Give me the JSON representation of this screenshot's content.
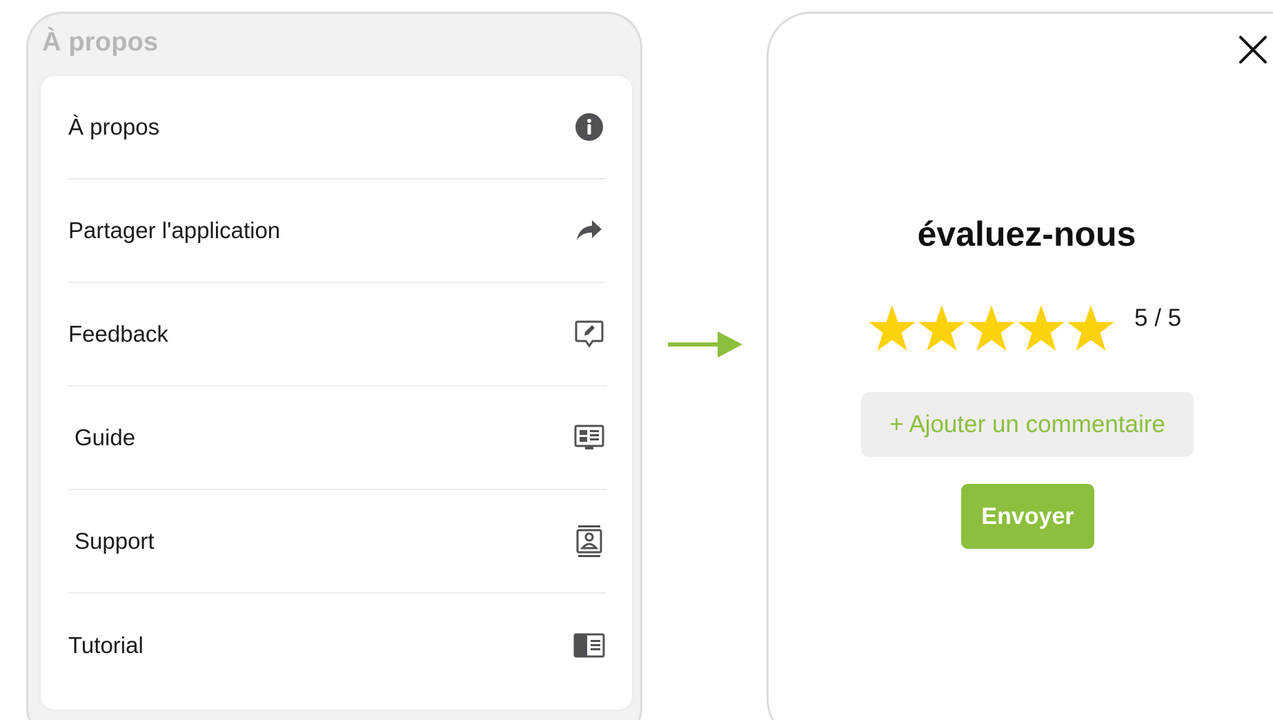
{
  "left_panel": {
    "header": "À propos",
    "items": [
      {
        "label": "À propos",
        "icon": "info-icon"
      },
      {
        "label": "Partager l'application",
        "icon": "share-icon"
      },
      {
        "label": "Feedback",
        "icon": "feedback-icon"
      },
      {
        "label": "Guide",
        "icon": "guide-icon"
      },
      {
        "label": "Support",
        "icon": "support-icon"
      },
      {
        "label": "Tutorial",
        "icon": "tutorial-icon"
      }
    ]
  },
  "flow_arrow": {
    "icon": "right-arrow-icon",
    "color": "#8cbf3d"
  },
  "rating_modal": {
    "close_icon": "close-icon",
    "title": "évaluez-nous",
    "rating": {
      "value": 5,
      "max": 5,
      "display": "5 / 5",
      "star_color": "#fbd20b"
    },
    "comment_button": "+ Ajouter un commentaire",
    "send_button": "Envoyer",
    "accent_color": "#8cbf3d"
  }
}
